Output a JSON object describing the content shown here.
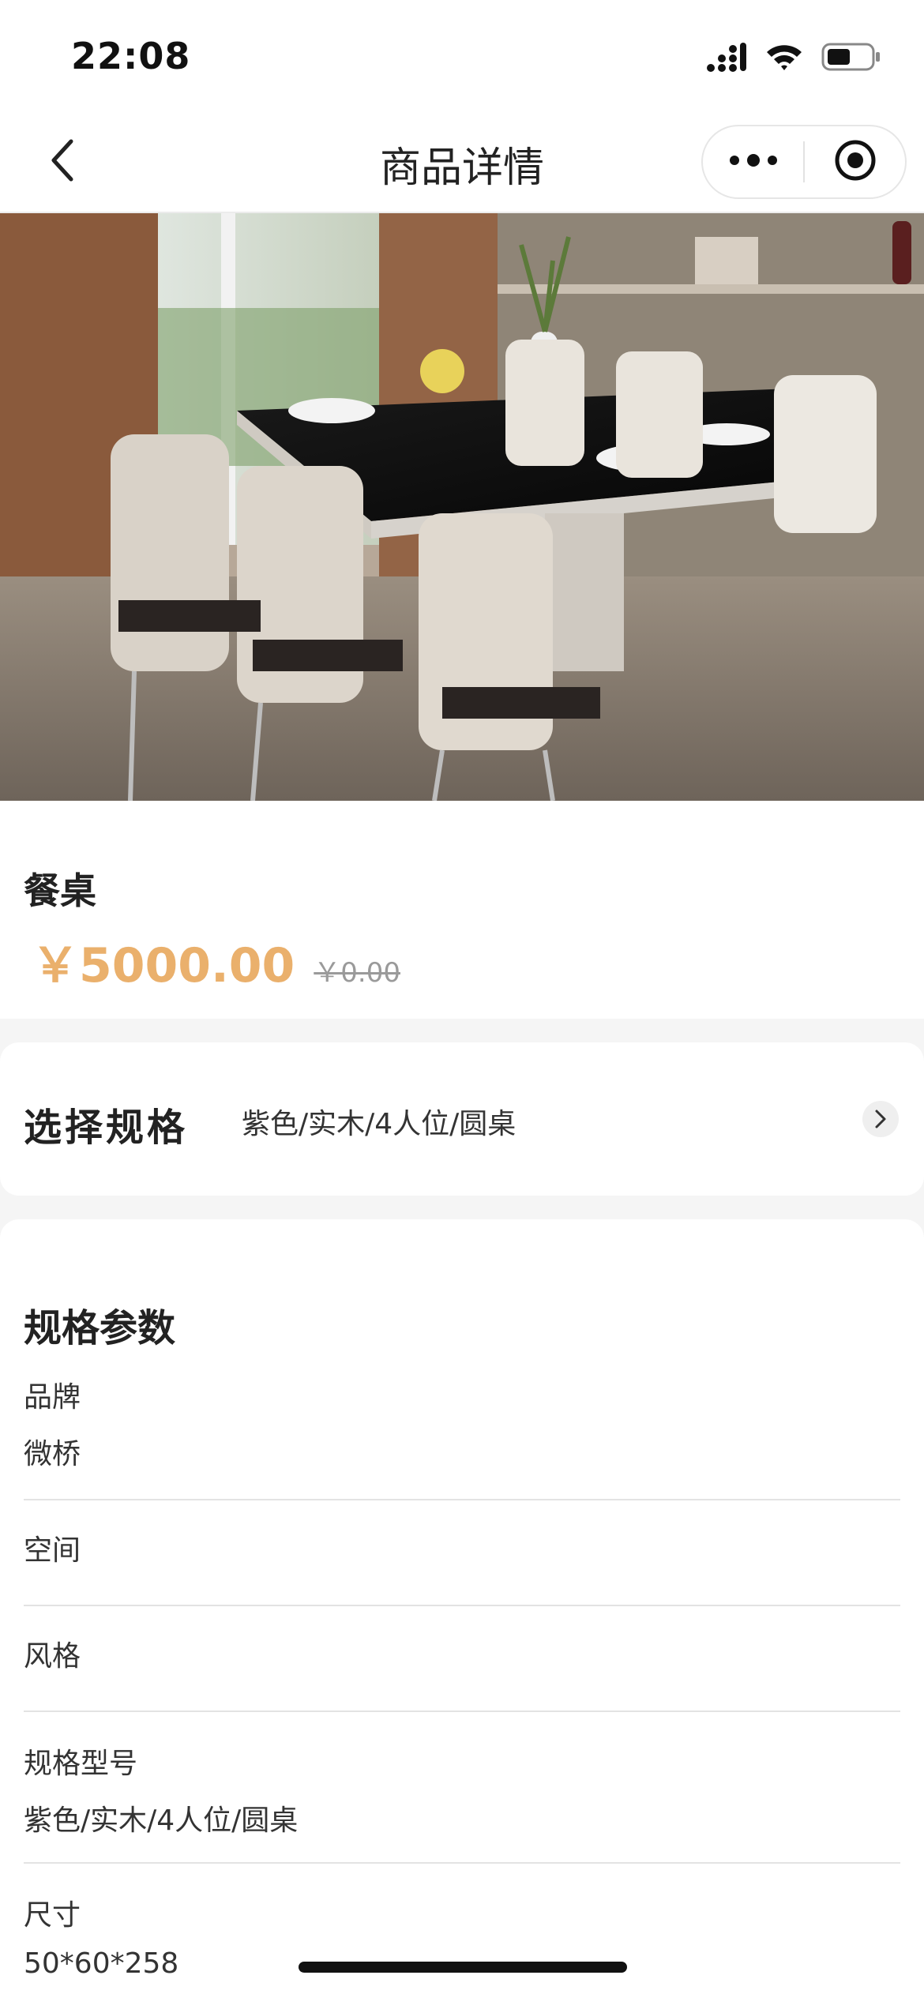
{
  "status_bar": {
    "time": "22:08",
    "icons": [
      "signal-icon",
      "wifi-icon",
      "battery-icon"
    ]
  },
  "nav": {
    "title": "商品详情",
    "back_icon": "chevron-left-icon",
    "menu_icon": "more-dots-icon",
    "close_icon": "target-circle-icon"
  },
  "product": {
    "name": "餐桌",
    "price": "￥5000.00",
    "original_price": "￥0.00",
    "price_color": "#eab06c"
  },
  "spec_select": {
    "label": "选择规格",
    "value": "紫色/实木/4人位/圆桌",
    "arrow_icon": "chevron-right-icon"
  },
  "params": {
    "title": "规格参数",
    "items": [
      {
        "label": "品牌",
        "value": "微桥"
      },
      {
        "label": "空间",
        "value": ""
      },
      {
        "label": "风格",
        "value": ""
      },
      {
        "label": "规格型号",
        "value": "紫色/实木/4人位/圆桌"
      },
      {
        "label": "尺寸",
        "value": "50*60*258"
      }
    ]
  }
}
